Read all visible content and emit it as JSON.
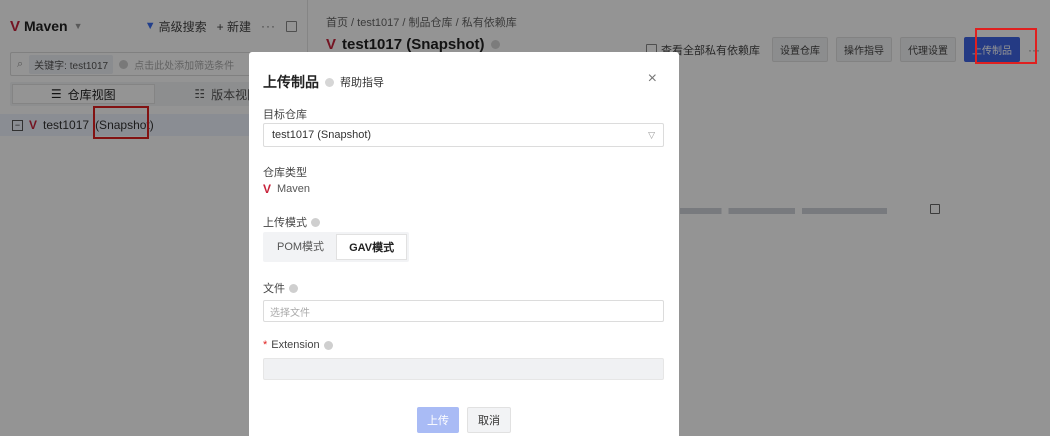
{
  "left": {
    "title": "Maven",
    "adv_search": "高级搜索",
    "new_label": "+ 新建",
    "more": "···",
    "search": {
      "keyword_tag": "关键字: test1017",
      "hint": "点击此处添加筛选条件"
    },
    "tabs": [
      {
        "label": "仓库视图",
        "active": true
      },
      {
        "label": "版本视图",
        "active": false
      }
    ],
    "tree": {
      "repo_name": "test1017",
      "repo_suffix": "(Snapshot)"
    }
  },
  "right": {
    "breadcrumb": "首页 / test1017 / 制品仓库 / 私有依赖库",
    "title": "test1017 (Snapshot)",
    "actions": {
      "view_all": "查看全部私有依赖库",
      "repo_settings": "设置仓库",
      "guide": "操作指导",
      "proxy": "代理设置",
      "upload": "上传制品",
      "more": "···"
    }
  },
  "modal": {
    "title": "上传制品",
    "help": "帮助指导",
    "close": "×",
    "target_repo_label": "目标仓库",
    "target_repo_value": "test1017 (Snapshot)",
    "repo_type_label": "仓库类型",
    "repo_type_value": "Maven",
    "upload_mode_label": "上传模式",
    "modes": [
      {
        "label": "POM模式",
        "active": false
      },
      {
        "label": "GAV模式",
        "active": true
      }
    ],
    "file_label": "文件",
    "file_placeholder": "选择文件",
    "extension_label": "Extension",
    "extension_required": "*",
    "upload_button": "上传",
    "cancel_button": "取消"
  },
  "colors": {
    "accent": "#3f64e4",
    "brand": "#c8233b",
    "highlight": "#e0201f"
  }
}
